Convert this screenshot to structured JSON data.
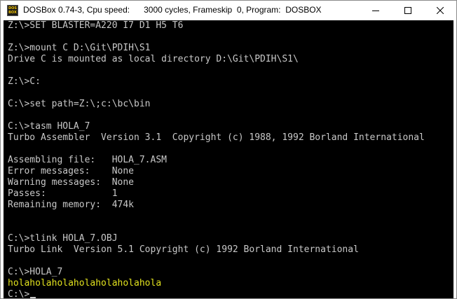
{
  "window": {
    "title": {
      "app": "DOSBox 0.74-3, Cpu speed:",
      "cycles": "3000 cycles, Frameskip  0, Program:",
      "program": "DOSBOX"
    },
    "icon_text": [
      "DOS",
      "BOX"
    ]
  },
  "console": {
    "text_color": "#c8c8c8",
    "highlight_color": "#e1e11e",
    "lines": [
      "Z:\\>SET BLASTER=A220 I7 D1 H5 T6",
      "",
      "Z:\\>mount C D:\\Git\\PDIH\\S1",
      "Drive C is mounted as local directory D:\\Git\\PDIH\\S1\\",
      "",
      "Z:\\>C:",
      "",
      "C:\\>set path=Z:\\;c:\\bc\\bin",
      "",
      "C:\\>tasm HOLA_7",
      "Turbo Assembler  Version 3.1  Copyright (c) 1988, 1992 Borland International",
      "",
      "Assembling file:   HOLA_7.ASM",
      "Error messages:    None",
      "Warning messages:  None",
      "Passes:            1",
      "Remaining memory:  474k",
      "",
      "",
      "C:\\>tlink HOLA_7.OBJ",
      "Turbo Link  Version 5.1 Copyright (c) 1992 Borland International",
      "",
      "C:\\>HOLA_7",
      "holaholaholaholaholaholahola",
      "C:\\>"
    ],
    "highlighted_line_index": 23
  }
}
